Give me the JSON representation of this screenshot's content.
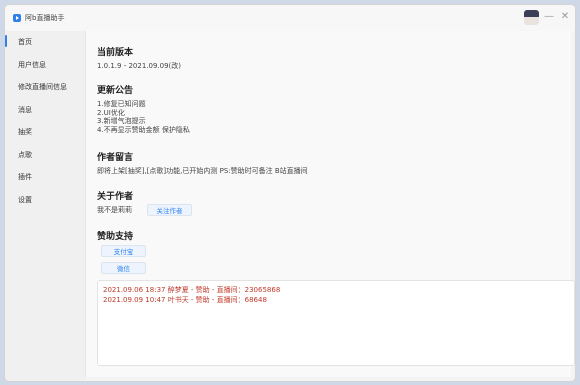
{
  "app": {
    "title": "阿b直播助手"
  },
  "sidebar": {
    "items": [
      {
        "label": "首页",
        "active": true
      },
      {
        "label": "用户信息"
      },
      {
        "label": "修改直播间信息"
      },
      {
        "label": "消息"
      },
      {
        "label": "抽奖"
      },
      {
        "label": "点歌"
      },
      {
        "label": "插件"
      },
      {
        "label": "设置"
      }
    ]
  },
  "home": {
    "version_title": "当前版本",
    "version_value": "1.0.1.9 - 2021.09.09(改)",
    "updates_title": "更新公告",
    "updates_lines": [
      "1.修复已知问题",
      "2.UI优化",
      "3.新增气泡提示",
      "4.不再显示赞助金额 保护隐私"
    ],
    "author_msg_title": "作者留言",
    "author_msg_text": "即将上架[抽奖],[点歌]功能,已开始内测   PS:赞助时可备注 B站直播间",
    "about_title": "关于作者",
    "author_name": "我不是莉莉",
    "follow_button": "关注作者",
    "sponsor_title": "赞助支持",
    "alipay_button": "支付宝",
    "wechat_button": "微信"
  },
  "sponsor_log": [
    "2021.09.06 18:37 醉梦夏 - 赞助 - 直播间：23065868",
    "2021.09.09 10:47 叶书天 - 赞助 - 直播间：68648"
  ],
  "colors": {
    "accent": "#2f80ed",
    "log_text": "#c0392b"
  }
}
